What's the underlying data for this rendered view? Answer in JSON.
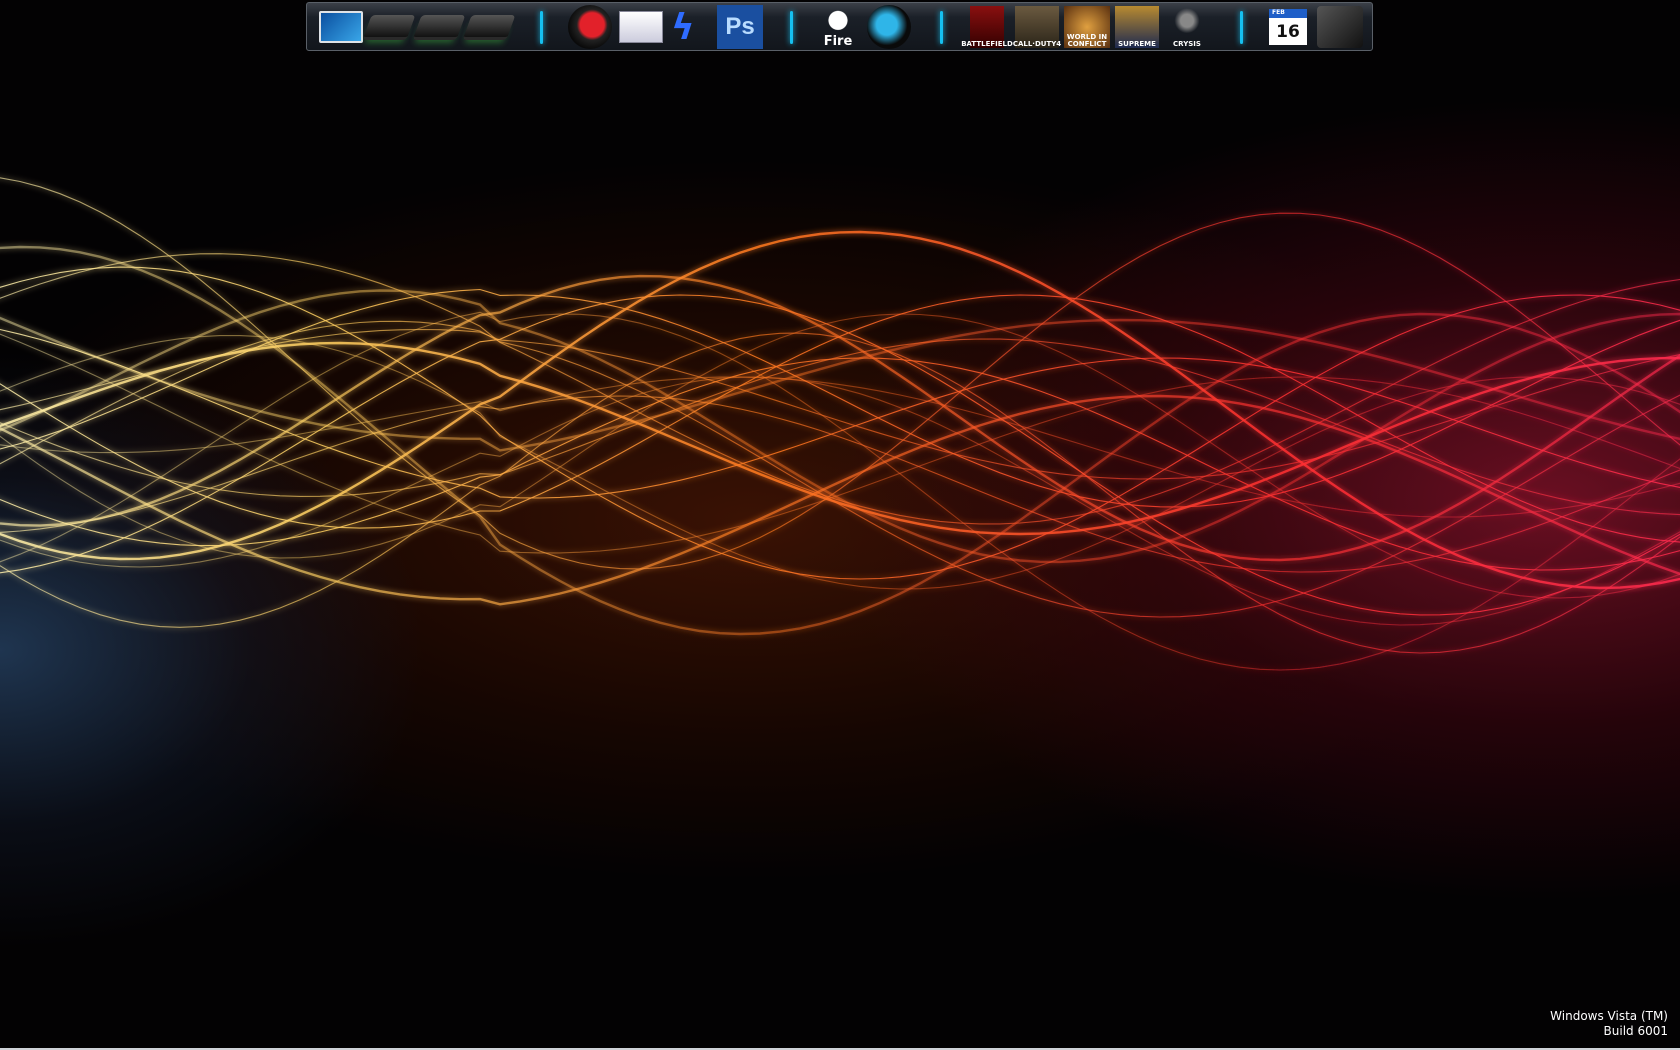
{
  "dock": {
    "items": [
      {
        "name": "computer-icon"
      },
      {
        "name": "drive-c-icon"
      },
      {
        "name": "drive-d-icon"
      },
      {
        "name": "drive-e-icon"
      },
      {
        "name": "firefox-icon"
      },
      {
        "name": "mail-sync-icon"
      },
      {
        "name": "lightning-icon"
      },
      {
        "name": "photoshop-icon",
        "label": "Ps"
      },
      {
        "name": "xfire-icon",
        "label": "Fire"
      },
      {
        "name": "ventrilo-icon"
      },
      {
        "name": "battlefield2-icon",
        "label": "BATTLEFIELD"
      },
      {
        "name": "call-of-duty-4-icon",
        "label": "CALL·DUTY4"
      },
      {
        "name": "world-in-conflict-icon",
        "label": "WORLD IN CONFLICT"
      },
      {
        "name": "supreme-commander-icon",
        "label": "SUPREME"
      },
      {
        "name": "crysis-icon",
        "label": "CRYSIS"
      },
      {
        "name": "calendar-icon",
        "month": "FEB",
        "day": "16"
      },
      {
        "name": "recycle-bin-icon"
      }
    ]
  },
  "watermark": {
    "line1": "Windows Vista (TM)",
    "line2": "Build 6001"
  },
  "colors": {
    "separator": "#16c0f0",
    "wave_start": "#ffe070",
    "wave_mid": "#ff6a1a",
    "wave_end": "#ff2a40"
  }
}
